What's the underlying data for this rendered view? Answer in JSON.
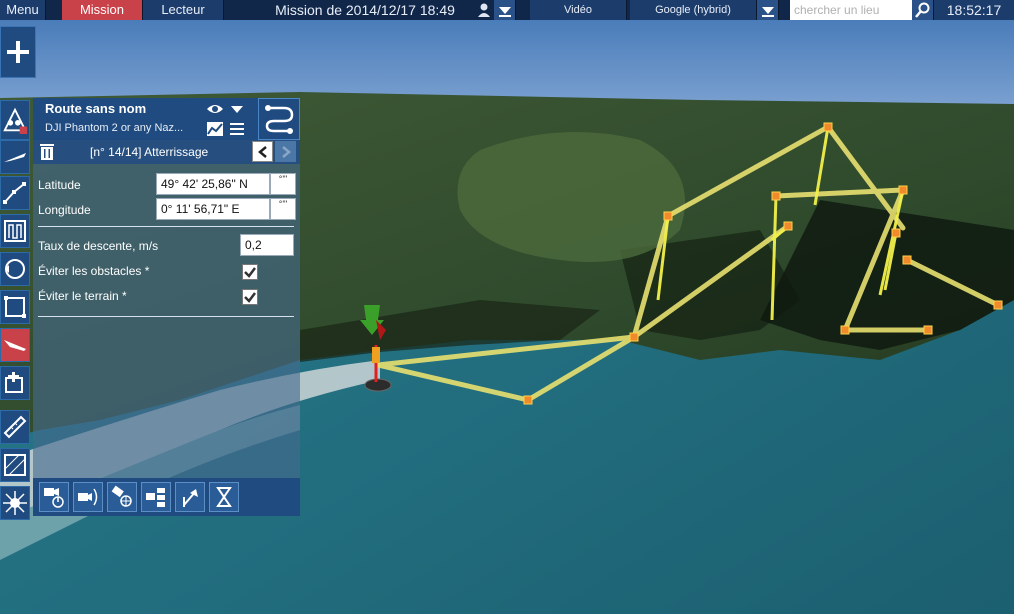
{
  "topbar": {
    "menu_label": "Menu",
    "mission_tab": "Mission",
    "lecteur_tab": "Lecteur",
    "mission_title": "Mission de 2014/12/17 18:49",
    "video_label": "Vidéo",
    "map_layer": "Google (hybrid)",
    "search_placeholder": "chercher un lieu",
    "clock": "18:52:17"
  },
  "route": {
    "name": "Route sans nom",
    "drone": "DJI Phantom 2 or any Naz..."
  },
  "waypoint": {
    "title": "[n° 14/14] Atterrissage",
    "latitude_label": "Latitude",
    "latitude_value": "49° 42' 25,86\" N",
    "longitude_label": "Longitude",
    "longitude_value": "0° 11' 56,71\" E",
    "coord_btn_label": "°'\"",
    "descent_label": "Taux de descente, m/s",
    "descent_value": "0,2",
    "avoid_obstacles_label": "Éviter les obstacles *",
    "avoid_obstacles": true,
    "avoid_terrain_label": "Éviter le terrain *",
    "avoid_terrain": true
  },
  "colors": {
    "accent": "#c9424a",
    "panel": "#1f4b80",
    "route_line": "#e8e070",
    "waypoint": "#f08a2a"
  }
}
